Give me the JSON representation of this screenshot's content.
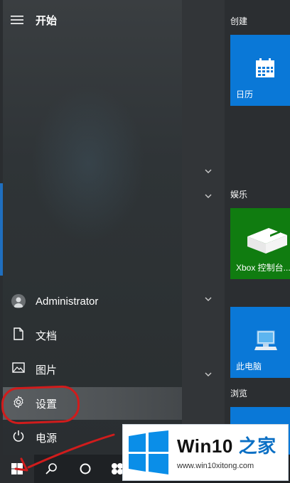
{
  "start_menu": {
    "title": "开始",
    "items": [
      {
        "label": "Administrator",
        "icon": "user-avatar-icon"
      },
      {
        "label": "文档",
        "icon": "document-icon"
      },
      {
        "label": "图片",
        "icon": "pictures-icon"
      },
      {
        "label": "设置",
        "icon": "gear-icon"
      },
      {
        "label": "电源",
        "icon": "power-icon"
      }
    ]
  },
  "tile_groups": [
    {
      "label": "创建"
    },
    {
      "label": "娱乐"
    },
    {
      "label": "浏览"
    }
  ],
  "tiles": [
    {
      "label": "日历",
      "icon": "calendar-icon",
      "color": "#0a78d7"
    },
    {
      "label": "Xbox 控制台...",
      "icon": "xbox-console-icon",
      "color": "#107c10"
    },
    {
      "label": "此电脑",
      "icon": "computer-icon",
      "color": "#0a78d7"
    }
  ],
  "taskbar": {
    "buttons": [
      "windows-start-icon",
      "search-icon",
      "cortana-icon"
    ]
  },
  "watermark": {
    "brand": "Win10",
    "brand_suffix": "之家",
    "url": "www.win10xitong.com"
  },
  "colors": {
    "accent_blue": "#0a78d7",
    "xbox_green": "#107c10",
    "annotation_red": "#d01c1c"
  }
}
